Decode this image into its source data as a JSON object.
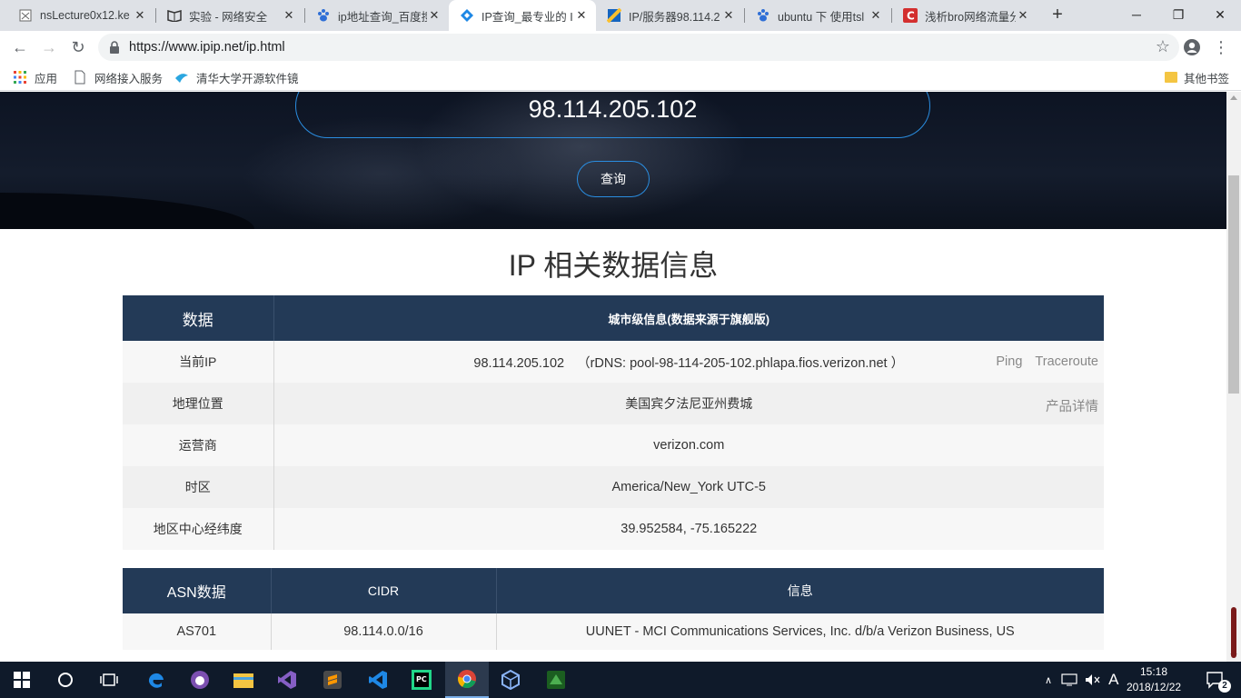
{
  "browser": {
    "tabs": [
      {
        "title": "nsLecture0x12.ke",
        "active": false
      },
      {
        "title": "实验 - 网络安全",
        "active": false
      },
      {
        "title": "ip地址查询_百度搜",
        "active": false
      },
      {
        "title": "IP查询_最专业的 I",
        "active": true
      },
      {
        "title": "IP/服务器98.114.2",
        "active": false
      },
      {
        "title": "ubuntu 下 使用tsl",
        "active": false
      },
      {
        "title": "浅析bro网络流量分",
        "active": false
      }
    ],
    "url": "https://www.ipip.net/ip.html",
    "bookmarks": [
      "应用",
      "网络接入服务",
      "清华大学开源软件镜"
    ],
    "other_bookmarks": "其他书签"
  },
  "page": {
    "ip_input_value": "98.114.205.102",
    "query_button": "查询",
    "section_title": "IP 相关数据信息",
    "info_table": {
      "header_key": "数据",
      "header_value": "城市级信息(数据来源于旗舰版)",
      "rows": [
        {
          "key": "当前IP",
          "value": "98.114.205.102",
          "rdns": "（rDNS: pool-98-114-205-102.phlapa.fios.verizon.net ）",
          "links": [
            "Ping",
            "Traceroute"
          ]
        },
        {
          "key": "地理位置",
          "value": "美国宾夕法尼亚州费城",
          "links": [
            "产品详情"
          ]
        },
        {
          "key": "运营商",
          "value": "verizon.com"
        },
        {
          "key": "时区",
          "value": "America/New_York UTC-5"
        },
        {
          "key": "地区中心经纬度",
          "value": "39.952584, -75.165222"
        }
      ]
    },
    "asn_table": {
      "headers": [
        "ASN数据",
        "CIDR",
        "信息"
      ],
      "rows": [
        {
          "asn": "AS701",
          "cidr": "98.114.0.0/16",
          "info": "UUNET - MCI Communications Services, Inc. d/b/a Verizon Business, US"
        }
      ]
    }
  },
  "taskbar": {
    "time": "15:18",
    "date": "2018/12/22",
    "ime": "A",
    "notification_count": "2"
  }
}
